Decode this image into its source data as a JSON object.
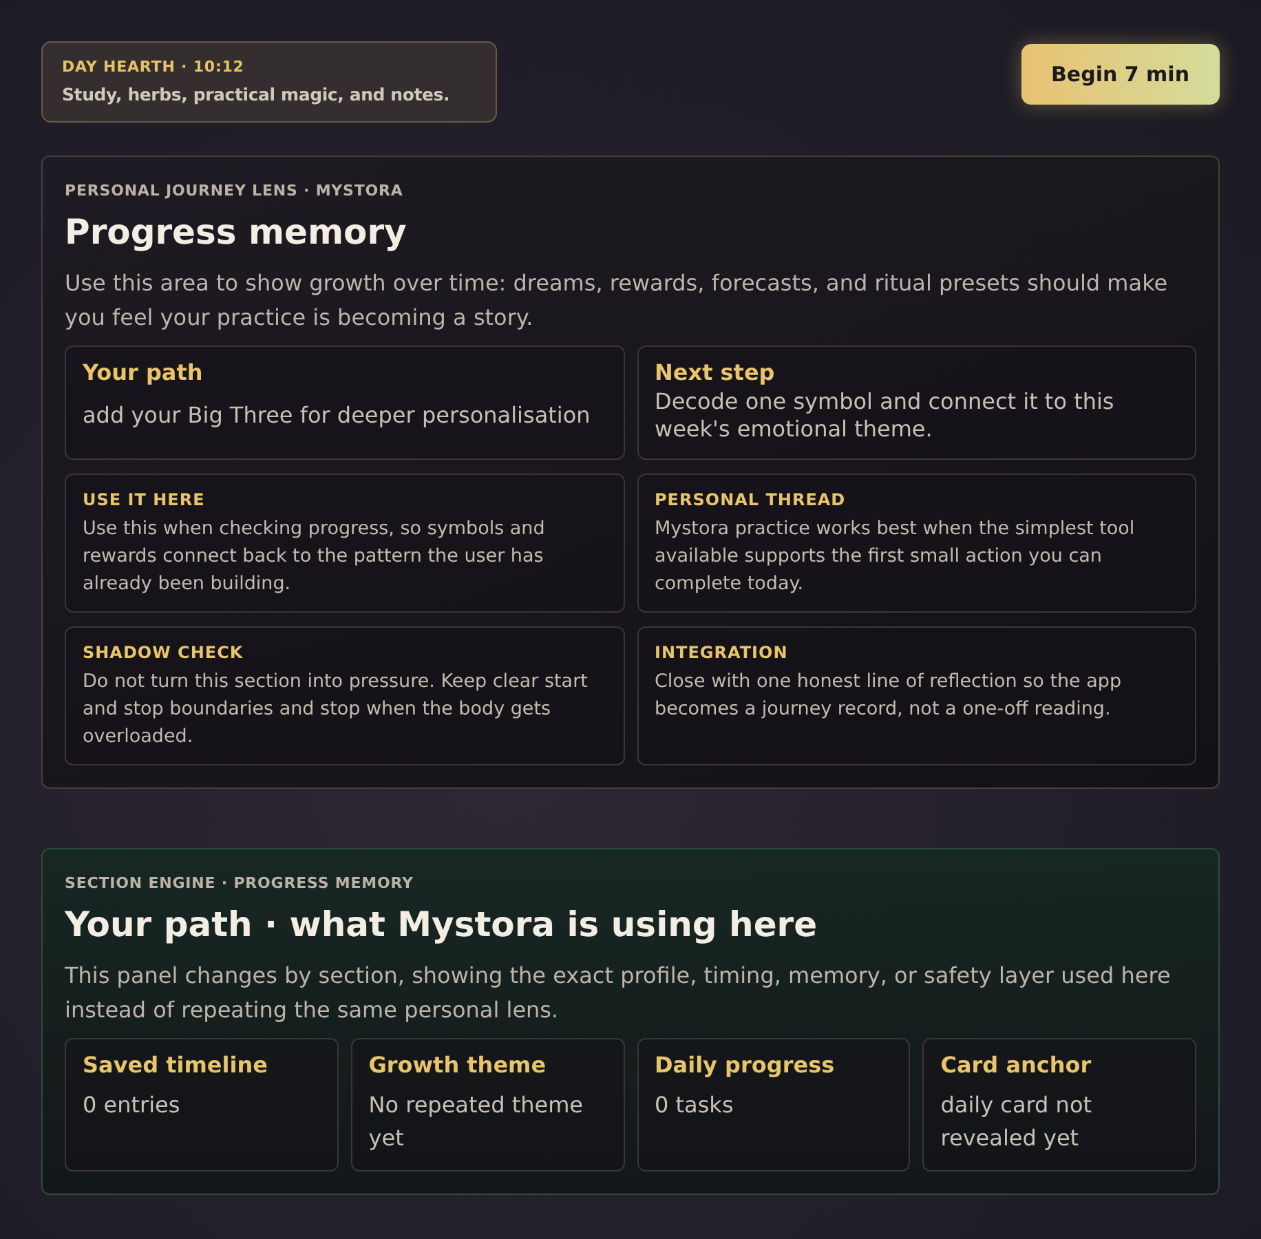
{
  "hearth": {
    "label": "DAY HEARTH · 10:12",
    "text": "Study, herbs, practical magic, and notes."
  },
  "begin_button": "Begin 7 min",
  "lens": {
    "eyebrow": "PERSONAL JOURNEY LENS · MYSTORA",
    "title": "Progress memory",
    "description": "Use this area to show growth over time: dreams, rewards, forecasts, and ritual presets should make you feel your practice is becoming a story.",
    "highlights": [
      {
        "title": "Your path",
        "text": "add your Big Three for deeper personalisation"
      },
      {
        "title": "Next step",
        "text": "Decode one symbol and connect it to this week's emotional theme."
      }
    ],
    "notes": [
      {
        "title": "USE IT HERE",
        "text": "Use this when checking progress, so symbols and rewards connect back to the pattern the user has already been building."
      },
      {
        "title": "PERSONAL THREAD",
        "text": "Mystora practice works best when the simplest tool available supports the first small action you can complete today."
      },
      {
        "title": "SHADOW CHECK",
        "text": "Do not turn this section into pressure. Keep clear start and stop boundaries and stop when the body gets overloaded."
      },
      {
        "title": "INTEGRATION",
        "text": "Close with one honest line of reflection so the app becomes a journey record, not a one-off reading."
      }
    ]
  },
  "engine": {
    "eyebrow": "SECTION ENGINE · PROGRESS MEMORY",
    "title": "Your path · what Mystora is using here",
    "description": "This panel changes by section, showing the exact profile, timing, memory, or safety layer used here instead of repeating the same personal lens.",
    "stats": [
      {
        "title": "Saved timeline",
        "value": "0 entries"
      },
      {
        "title": "Growth theme",
        "value": "No repeated theme yet"
      },
      {
        "title": "Daily progress",
        "value": "0 tasks"
      },
      {
        "title": "Card anchor",
        "value": "daily card not revealed yet"
      }
    ]
  }
}
